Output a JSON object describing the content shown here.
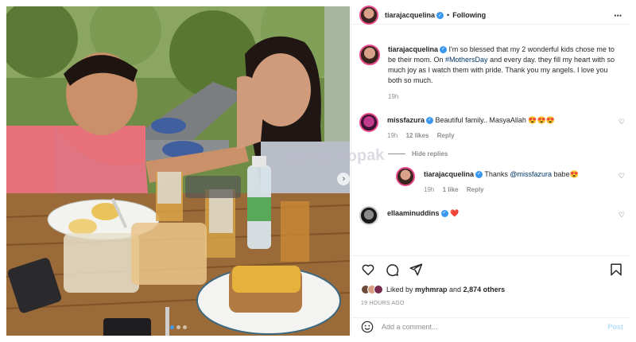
{
  "post": {
    "username": "tiarajacquelina",
    "follow_label": "Following",
    "more_icon": "more-horizontal-icon",
    "carousel_total": 3,
    "carousel_index": 0
  },
  "caption": {
    "username": "tiarajacquelina",
    "text_before": "I'm so blessed that my 2 wonderful kids chose me to be their mom. On ",
    "hashtag": "#MothersDay",
    "text_after": " and every day. they fill my heart with so much joy as I watch them with pride. Thank you my angels. I love you both so much.",
    "time": "19h"
  },
  "comments": [
    {
      "username": "missfazura",
      "text": "Beautiful family.. MasyaAllah 😍😍😍",
      "time": "19h",
      "likes": "12 likes",
      "reply": "Reply"
    },
    {
      "username": "tiarajacquelina",
      "text_before": "Thanks ",
      "mention": "@missfazura",
      "text_after": " babe😍",
      "time": "19h",
      "likes": "1 like",
      "reply": "Reply"
    },
    {
      "username": "ellaaminuddins",
      "text": "❤️"
    }
  ],
  "hide_replies": "Hide replies",
  "likes": {
    "prefix": "Liked by ",
    "user": "myhmrap",
    "middle": " and ",
    "count": "2,874 others"
  },
  "time_ago": "19 HOURS AGO",
  "add_comment": {
    "placeholder": "Add a comment...",
    "post_label": "Post"
  },
  "watermark": "Berita Kopak",
  "colors": {
    "link": "#00376b",
    "verified": "#3897f0",
    "post_button": "#b2dffc",
    "story_ring": "#e84a8a"
  }
}
